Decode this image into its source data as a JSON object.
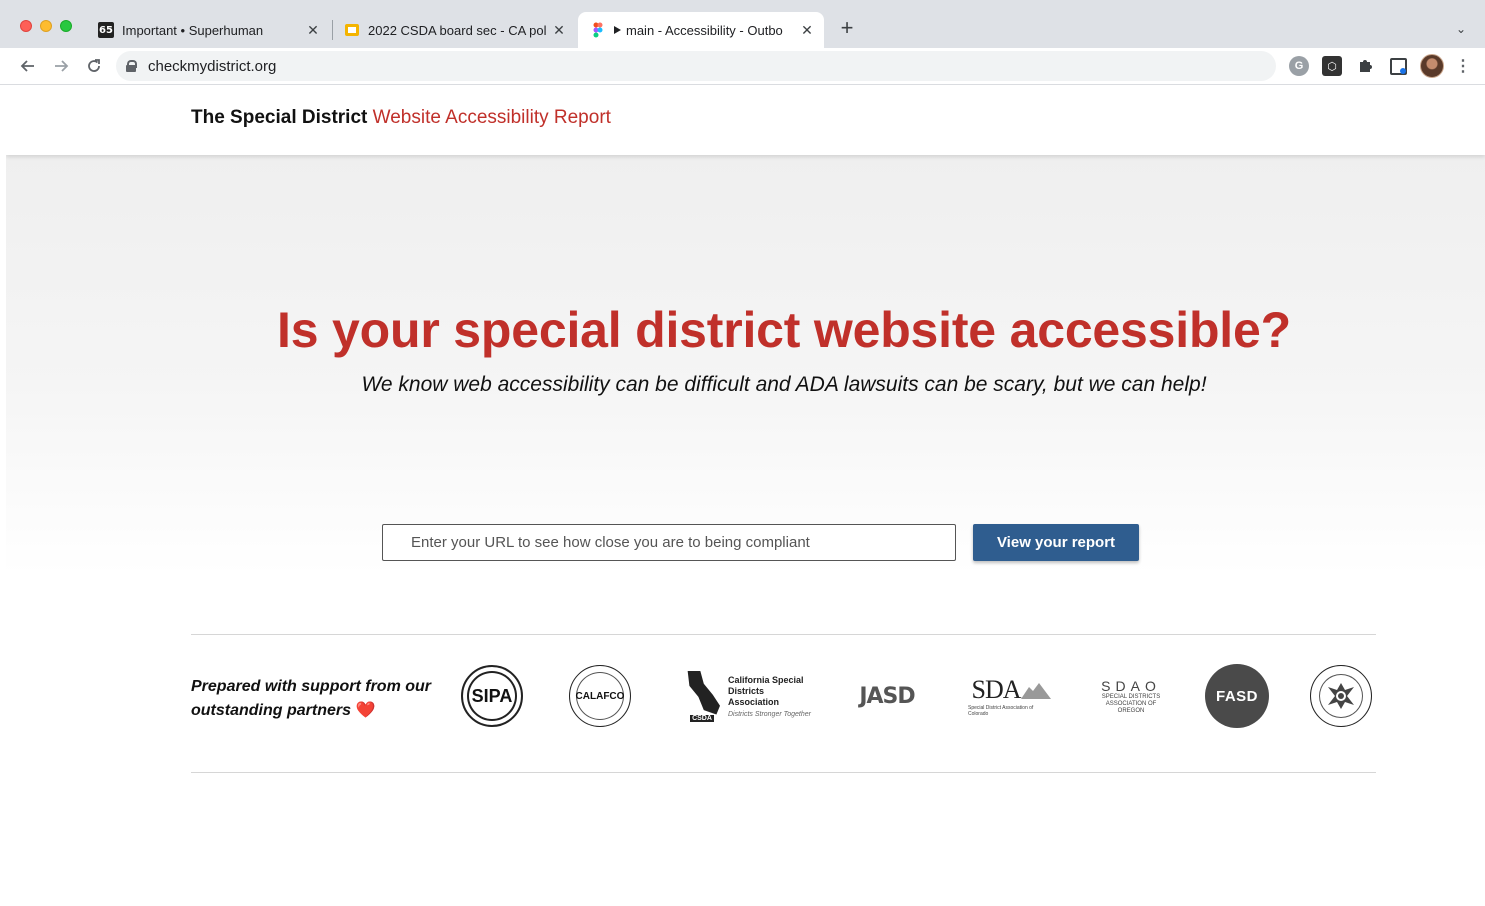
{
  "browser": {
    "tabs": [
      {
        "favicon_text": "65",
        "title": "Important • Superhuman"
      },
      {
        "title": "2022 CSDA board sec - CA pol"
      },
      {
        "title": "main - Accessibility - Outbo"
      }
    ],
    "close_glyph": "✕",
    "new_tab_glyph": "+",
    "tab_menu_glyph": "⌄",
    "url": "checkmydistrict.org",
    "ext_g": "G",
    "ext_box": "⬡"
  },
  "site": {
    "brand_bold": "The Special District",
    "brand_red": "Website Accessibility Report"
  },
  "hero": {
    "headline": "Is your special district website accessible?",
    "subhead": "We know web accessibility can be difficult and ADA lawsuits can be scary, but we can help!",
    "input_placeholder": "Enter your URL to see how close you are to being compliant",
    "cta_label": "View your report"
  },
  "partners": {
    "text": "Prepared with support from our outstanding partners",
    "heart": "❤️",
    "logos": {
      "sipa": "SIPA",
      "calafco": "CALAFCO",
      "csda_name": "California Special Districts Association",
      "csda_abbr": "CSDA",
      "csda_tagline": "Districts Stronger Together",
      "jasd": "JASD",
      "sda": "SDA",
      "sda_sub": "Special District Association of Colorado",
      "sdao": "SDAO",
      "sdao_sub": "SPECIAL DISTRICTS ASSOCIATION OF OREGON",
      "fasd": "FASD"
    }
  },
  "colors": {
    "accent_red": "#c0302a",
    "cta_blue": "#2f5d8f"
  }
}
